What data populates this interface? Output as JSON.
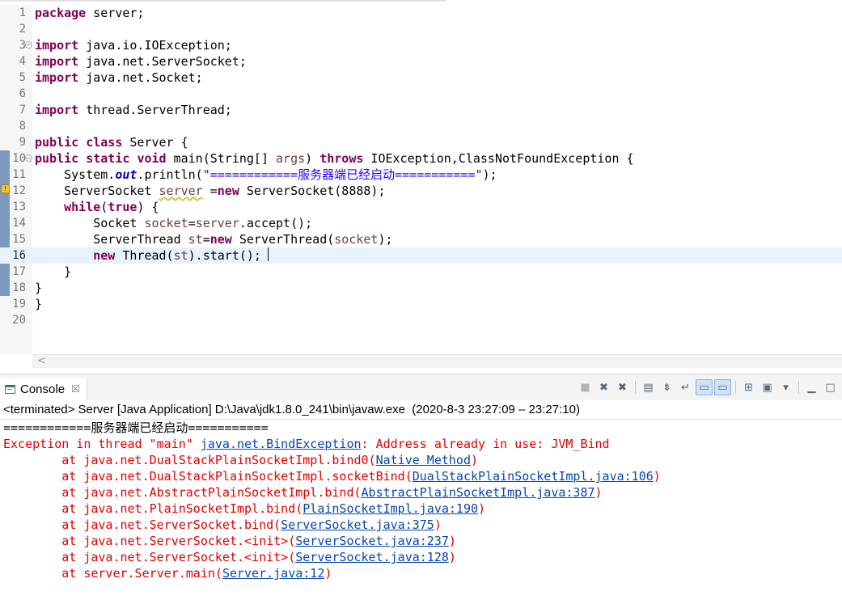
{
  "editor": {
    "lines": [
      {
        "n": "1",
        "parts": [
          [
            "kw",
            "package"
          ],
          [
            "plain",
            " server;"
          ]
        ]
      },
      {
        "n": "2",
        "parts": []
      },
      {
        "n": "3",
        "fold": true,
        "parts": [
          [
            "kw",
            "import"
          ],
          [
            "plain",
            " java.io.IOException;"
          ]
        ]
      },
      {
        "n": "4",
        "parts": [
          [
            "kw",
            "import"
          ],
          [
            "plain",
            " java.net.ServerSocket;"
          ]
        ]
      },
      {
        "n": "5",
        "parts": [
          [
            "kw",
            "import"
          ],
          [
            "plain",
            " java.net.Socket;"
          ]
        ]
      },
      {
        "n": "6",
        "parts": []
      },
      {
        "n": "7",
        "parts": [
          [
            "kw",
            "import"
          ],
          [
            "plain",
            " thread.ServerThread;"
          ]
        ]
      },
      {
        "n": "8",
        "parts": []
      },
      {
        "n": "9",
        "parts": [
          [
            "kw",
            "public"
          ],
          [
            "plain",
            " "
          ],
          [
            "kw",
            "class"
          ],
          [
            "plain",
            " Server {"
          ]
        ]
      },
      {
        "n": "10",
        "fold": true,
        "changed": true,
        "parts": [
          [
            "kw",
            "public"
          ],
          [
            "plain",
            " "
          ],
          [
            "kw",
            "static"
          ],
          [
            "plain",
            " "
          ],
          [
            "kw",
            "void"
          ],
          [
            "plain",
            " main(String[] "
          ],
          [
            "var",
            "args"
          ],
          [
            "plain",
            ") "
          ],
          [
            "kw",
            "throws"
          ],
          [
            "plain",
            " IOException,ClassNotFoundException {"
          ]
        ]
      },
      {
        "n": "11",
        "changed": true,
        "parts": [
          [
            "plain",
            "    System."
          ],
          [
            "fld",
            "out"
          ],
          [
            "plain",
            ".println("
          ],
          [
            "str",
            "\"============服务器端已经启动===========\""
          ],
          [
            "plain",
            ");"
          ]
        ]
      },
      {
        "n": "12",
        "changed": true,
        "warning": true,
        "parts": [
          [
            "plain",
            "    ServerSocket "
          ],
          [
            "varwarn",
            "server"
          ],
          [
            "plain",
            " ="
          ],
          [
            "kw",
            "new"
          ],
          [
            "plain",
            " ServerSocket(8888);"
          ]
        ]
      },
      {
        "n": "13",
        "changed": true,
        "parts": [
          [
            "plain",
            "    "
          ],
          [
            "kw",
            "while"
          ],
          [
            "plain",
            "("
          ],
          [
            "kw",
            "true"
          ],
          [
            "plain",
            ") {"
          ]
        ]
      },
      {
        "n": "14",
        "changed": true,
        "parts": [
          [
            "plain",
            "        Socket "
          ],
          [
            "var",
            "socket"
          ],
          [
            "plain",
            "="
          ],
          [
            "var",
            "server"
          ],
          [
            "plain",
            ".accept();"
          ]
        ]
      },
      {
        "n": "15",
        "changed": true,
        "parts": [
          [
            "plain",
            "        ServerThread "
          ],
          [
            "var",
            "st"
          ],
          [
            "plain",
            "="
          ],
          [
            "kw",
            "new"
          ],
          [
            "plain",
            " ServerThread("
          ],
          [
            "var",
            "socket"
          ],
          [
            "plain",
            ");"
          ]
        ]
      },
      {
        "n": "16",
        "changed": true,
        "current": true,
        "parts": [
          [
            "plain",
            "        "
          ],
          [
            "kw",
            "new"
          ],
          [
            "plain",
            " Thread("
          ],
          [
            "var",
            "st"
          ],
          [
            "plain",
            ").start(); "
          ]
        ]
      },
      {
        "n": "17",
        "changed": true,
        "parts": [
          [
            "plain",
            "    }"
          ]
        ]
      },
      {
        "n": "18",
        "changed": true,
        "parts": [
          [
            "plain",
            "}"
          ]
        ]
      },
      {
        "n": "19",
        "parts": [
          [
            "plain",
            "}"
          ]
        ]
      },
      {
        "n": "20",
        "parts": []
      }
    ],
    "scroll_left_glyph": "<"
  },
  "console": {
    "tab_title": "Console",
    "close_glyph": "☒",
    "description": "<terminated> Server [Java Application] D:\\Java\\jdk1.8.0_241\\bin\\javaw.exe  (2020-8-3 23:27:09 – 23:27:10)",
    "toolbar": [
      {
        "name": "terminate-button",
        "glyph": "■",
        "state": "disabled"
      },
      {
        "name": "remove-launch-button",
        "glyph": "✖",
        "state": "normal"
      },
      {
        "name": "remove-all-terminated-button",
        "glyph": "✖",
        "state": "normal"
      },
      {
        "name": "sep1",
        "glyph": "",
        "state": "separator"
      },
      {
        "name": "clear-console-button",
        "glyph": "▤",
        "state": "normal"
      },
      {
        "name": "scroll-lock-button",
        "glyph": "⇟",
        "state": "normal"
      },
      {
        "name": "word-wrap-button",
        "glyph": "↵",
        "state": "normal"
      },
      {
        "name": "show-on-stdout-button",
        "glyph": "▭",
        "state": "pressed"
      },
      {
        "name": "show-on-stderr-button",
        "glyph": "▭",
        "state": "pressed"
      },
      {
        "name": "sep2",
        "glyph": "",
        "state": "separator"
      },
      {
        "name": "pin-console-button",
        "glyph": "⊞",
        "state": "normal"
      },
      {
        "name": "display-console-button",
        "glyph": "▣",
        "state": "normal"
      },
      {
        "name": "display-console-menu",
        "glyph": "▾",
        "state": "normal"
      },
      {
        "name": "sep3",
        "glyph": "",
        "state": "separator"
      },
      {
        "name": "minimize-button",
        "glyph": "▁",
        "state": "normal"
      },
      {
        "name": "maximize-button",
        "glyph": "□",
        "state": "normal"
      }
    ],
    "output": [
      {
        "style": "normal",
        "parts": [
          [
            "t",
            "============服务器端已经启动==========="
          ]
        ]
      },
      {
        "style": "err",
        "parts": [
          [
            "t",
            "Exception in thread \"main\" "
          ],
          [
            "link",
            "java.net.BindException"
          ],
          [
            "t",
            ": Address already in use: JVM_Bind"
          ]
        ]
      },
      {
        "style": "err",
        "parts": [
          [
            "t",
            "        at java.net.DualStackPlainSocketImpl.bind0("
          ],
          [
            "link",
            "Native Method"
          ],
          [
            "t",
            ")"
          ]
        ]
      },
      {
        "style": "err",
        "parts": [
          [
            "t",
            "        at java.net.DualStackPlainSocketImpl.socketBind("
          ],
          [
            "link",
            "DualStackPlainSocketImpl.java:106"
          ],
          [
            "t",
            ")"
          ]
        ]
      },
      {
        "style": "err",
        "parts": [
          [
            "t",
            "        at java.net.AbstractPlainSocketImpl.bind("
          ],
          [
            "link",
            "AbstractPlainSocketImpl.java:387"
          ],
          [
            "t",
            ")"
          ]
        ]
      },
      {
        "style": "err",
        "parts": [
          [
            "t",
            "        at java.net.PlainSocketImpl.bind("
          ],
          [
            "link",
            "PlainSocketImpl.java:190"
          ],
          [
            "t",
            ")"
          ]
        ]
      },
      {
        "style": "err",
        "parts": [
          [
            "t",
            "        at java.net.ServerSocket.bind("
          ],
          [
            "link",
            "ServerSocket.java:375"
          ],
          [
            "t",
            ")"
          ]
        ]
      },
      {
        "style": "err",
        "parts": [
          [
            "t",
            "        at java.net.ServerSocket.<init>("
          ],
          [
            "link",
            "ServerSocket.java:237"
          ],
          [
            "t",
            ")"
          ]
        ]
      },
      {
        "style": "err",
        "parts": [
          [
            "t",
            "        at java.net.ServerSocket.<init>("
          ],
          [
            "link",
            "ServerSocket.java:128"
          ],
          [
            "t",
            ")"
          ]
        ]
      },
      {
        "style": "err",
        "parts": [
          [
            "t",
            "        at server.Server.main("
          ],
          [
            "link",
            "Server.java:12"
          ],
          [
            "t",
            ")"
          ]
        ]
      }
    ]
  }
}
